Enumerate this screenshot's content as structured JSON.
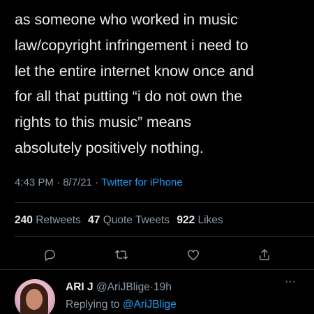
{
  "tweet": {
    "text_lines": [
      "as someone who worked in music",
      "law/copyright infringement i need to",
      "let the entire internet know once and",
      "for all that putting “i do not own the",
      "rights to this music” means",
      "absolutely positively nothing."
    ],
    "time": "4:43 PM",
    "date": "8/7/21",
    "separator": "·",
    "source": "Twitter for iPhone"
  },
  "stats": {
    "retweets_count": "240",
    "retweets_label": "Retweets",
    "quotes_count": "47",
    "quotes_label": "Quote Tweets",
    "likes_count": "922",
    "likes_label": "Likes"
  },
  "actions": {
    "icons": [
      "reply-icon",
      "retweet-icon",
      "like-icon",
      "share-icon"
    ]
  },
  "reply": {
    "name": "ARI J",
    "handle": "@AriJBlige",
    "separator": "·",
    "age": "19h",
    "replying_to_label": "Replying to",
    "replying_to_handle": "@AriJBlige",
    "more": "···"
  },
  "colors": {
    "background": "#000000",
    "text": "#e7e9ea",
    "secondary": "#8b98a5",
    "link": "#1d9bf0",
    "divider": "#2f3336"
  }
}
